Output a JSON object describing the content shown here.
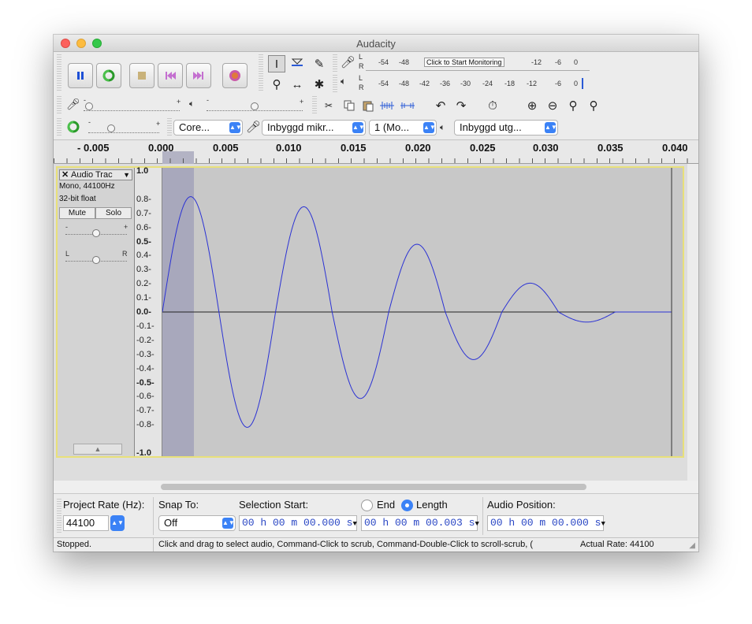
{
  "window": {
    "title": "Audacity"
  },
  "toolbar": {
    "pause_icon": "pause-icon",
    "loop_icon": "loop-icon",
    "stop_icon": "stop-icon",
    "skip_start_icon": "skip-start-icon",
    "skip_end_icon": "skip-end-icon",
    "record_icon": "record-icon"
  },
  "meters": {
    "record_scale": [
      "-54",
      "-48",
      "-12",
      "-6",
      "0"
    ],
    "record_monitor_label": "Click to Start Monitoring",
    "playback_scale": [
      "-54",
      "-48",
      "-42",
      "-36",
      "-30",
      "-24",
      "-18",
      "-12",
      "-6",
      "0"
    ],
    "channel_l": "L",
    "channel_r": "R"
  },
  "mixer": {
    "minus": "-",
    "plus": "+"
  },
  "devices": {
    "host": "Core...",
    "record_device": "Inbyggd mikr...",
    "channels": "1 (Mo...",
    "playback_device": "Inbyggd utg..."
  },
  "ruler": {
    "labels": [
      "- 0.005",
      "0.000",
      "0.005",
      "0.010",
      "0.015",
      "0.020",
      "0.025",
      "0.030",
      "0.035",
      "0.040"
    ]
  },
  "track": {
    "name": "Audio Trac",
    "format": "Mono, 44100Hz",
    "sample_format": "32-bit float",
    "mute_label": "Mute",
    "solo_label": "Solo",
    "pan_left": "L",
    "pan_right": "R",
    "gain_minus": "-",
    "gain_plus": "+"
  },
  "amplitude_ruler": [
    "1.0",
    "0.8-",
    "0.7-",
    "0.6-",
    "0.5-",
    "0.4-",
    "0.3-",
    "0.2-",
    "0.1-",
    "0.0-",
    "-0.1-",
    "-0.2-",
    "-0.3-",
    "-0.4-",
    "-0.5-",
    "-0.6-",
    "-0.7-",
    "-0.8-",
    "-1.0"
  ],
  "selection_toolbar": {
    "project_rate_label": "Project Rate (Hz):",
    "project_rate_value": "44100",
    "snap_to_label": "Snap To:",
    "snap_to_value": "Off",
    "selection_start_label": "Selection Start:",
    "end_label": "End",
    "length_label": "Length",
    "audio_position_label": "Audio Position:",
    "selection_start_value": "00 h 00 m 00.000 s",
    "length_value": "00 h 00 m 00.003 s",
    "audio_position_value": "00 h 00 m 00.000 s",
    "length_selected": true
  },
  "status": {
    "state": "Stopped.",
    "hint": "Click and drag to select audio, Command-Click to scrub, Command-Double-Click to scroll-scrub, (",
    "actual_rate": "Actual Rate: 44100"
  },
  "colors": {
    "waveform": "#2b32d4",
    "track_background": "#c8c8c8",
    "selection": "#a8a8bc",
    "focus_border": "#e8e07a",
    "time_text": "#2946c4",
    "radio_selected": "#3b82f6"
  },
  "waveform": {
    "description_source": "damped sine wave",
    "peaks": [
      0.8,
      -0.8,
      0.73,
      -0.6,
      0.47,
      -0.33,
      0.2,
      -0.07,
      0.0
    ]
  }
}
